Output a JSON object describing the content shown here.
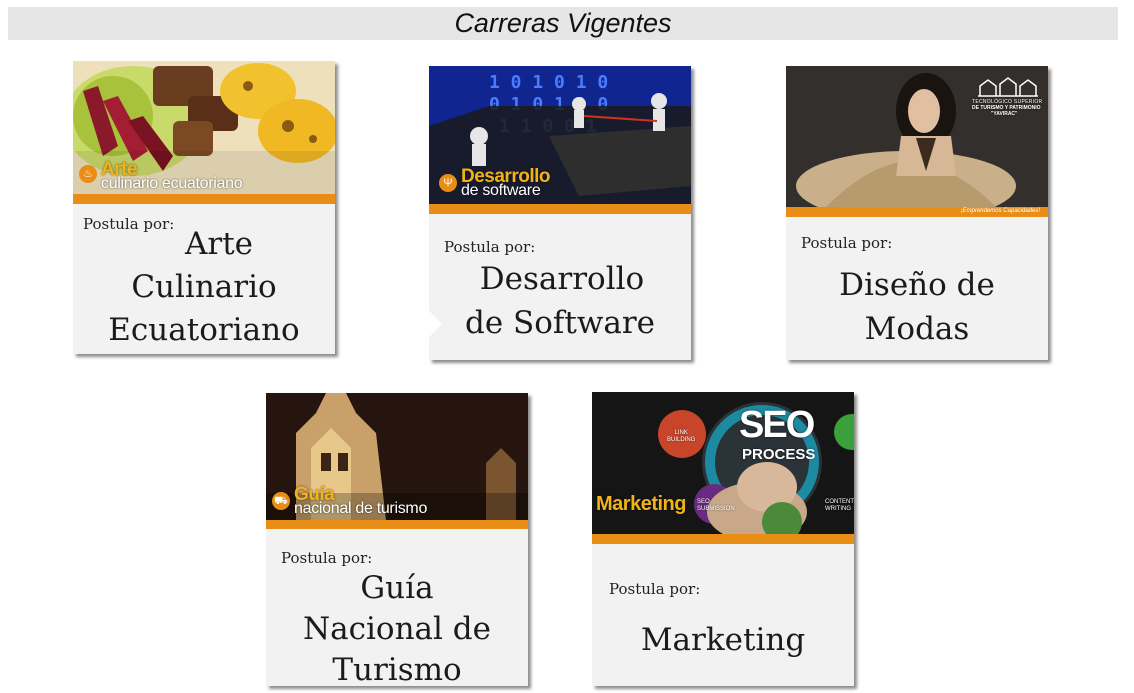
{
  "header": {
    "title": "Carreras Vigentes"
  },
  "colors": {
    "accent": "#e88d16",
    "card_bg": "#f2f2f2",
    "header_bg": "#e6e6e6"
  },
  "cards": [
    {
      "postula": "Postula por:",
      "lines": [
        "Arte",
        "Culinario",
        "Ecuatoriano"
      ],
      "img_title": "Arte",
      "img_subtitle": "culinario ecuatoriano",
      "icon": "chef-hat-icon"
    },
    {
      "postula": "Postula por:",
      "lines": [
        "Desarrollo",
        "de Software"
      ],
      "img_title": "Desarrollo",
      "img_subtitle": "de software",
      "icon": "code-plug-icon"
    },
    {
      "postula": "Postula por:",
      "lines": [
        "Diseño de",
        "Modas"
      ],
      "logo_lines": [
        "TECNOLÓGICO SUPERIOR",
        "DE TURISMO Y PATRIMONIO",
        "\"YAVIRAC\""
      ],
      "band_text": "¡Emprendemos Capacidades!",
      "icon": "building-logo-icon"
    },
    {
      "postula": "Postula por:",
      "lines": [
        "Guía",
        "Nacional de",
        "Turismo"
      ],
      "img_title": "Guía",
      "img_subtitle": "nacional de turismo",
      "icon": "tour-bus-icon"
    },
    {
      "postula": "Postula por:",
      "lines": [
        "Marketing"
      ],
      "img_title": "Marketing",
      "seo_big": "SEO",
      "seo_small": "PROCESS",
      "bubble_link": "LINK\nBUILDING",
      "bubble_seo": "SEO\nSUBMISSION",
      "bubble_content": "CONTENT\nWRITING"
    }
  ]
}
